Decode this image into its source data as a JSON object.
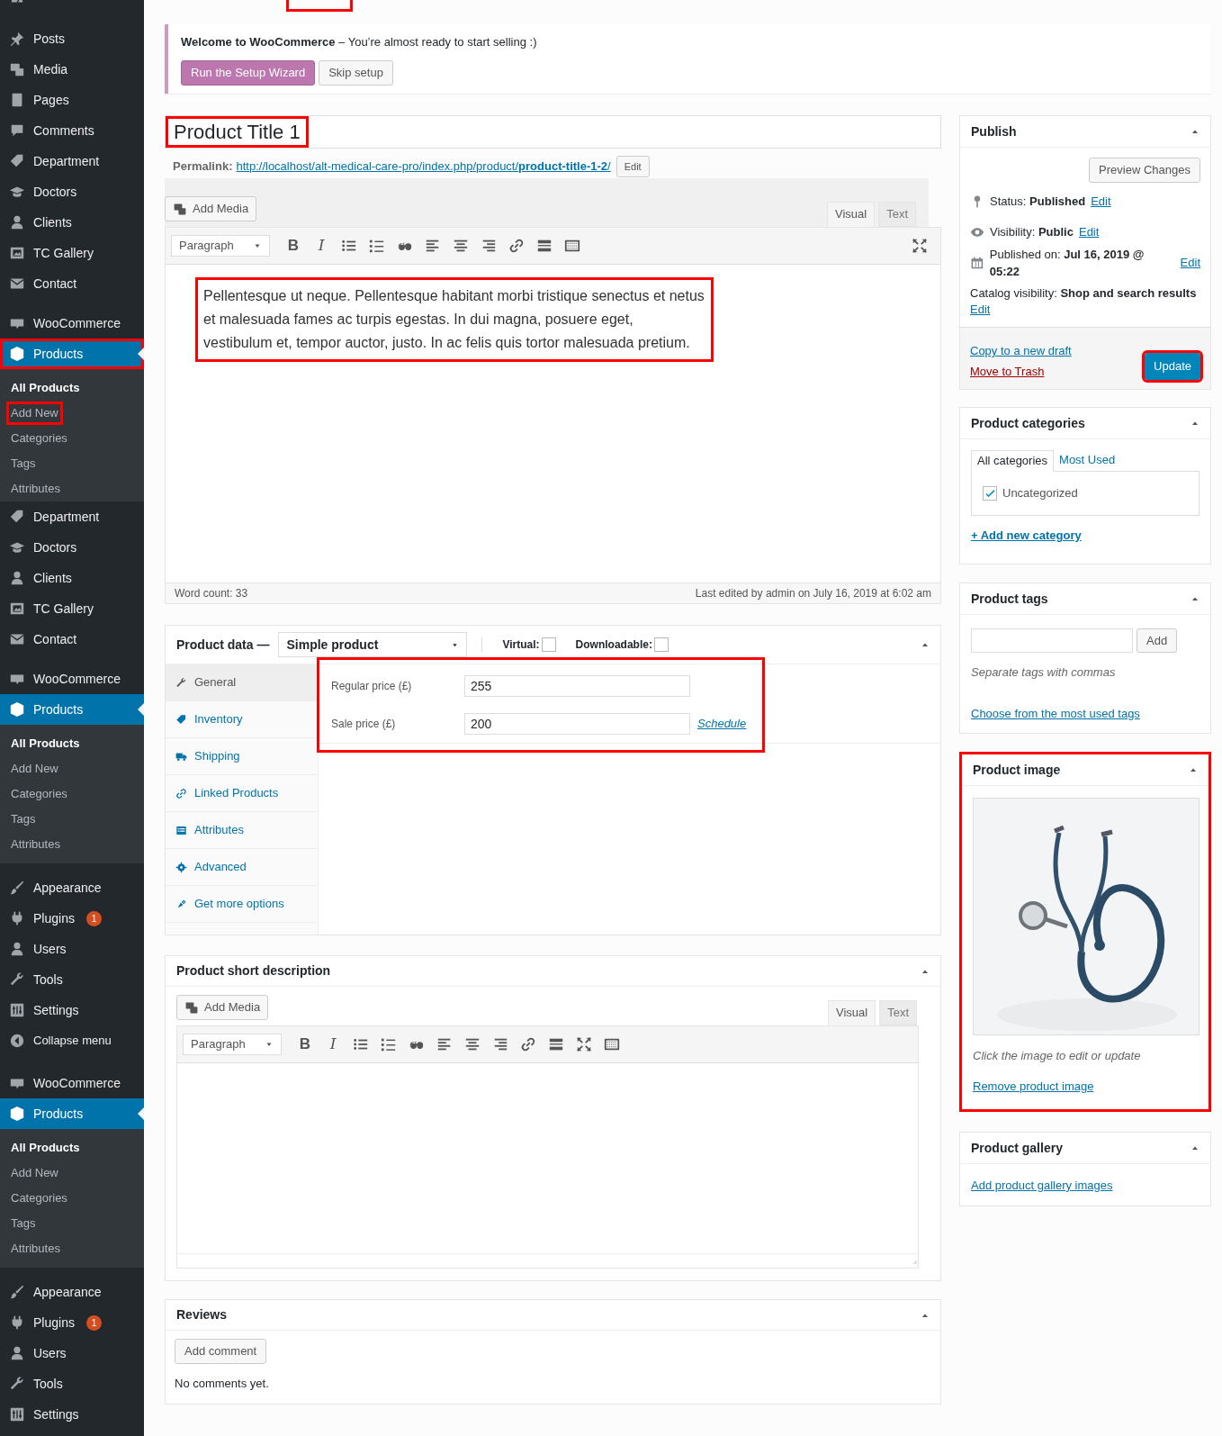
{
  "sidebar": {
    "groups": [
      [
        {
          "kind": "menu",
          "selected": false,
          "highlighted": false
        }
      ],
      [
        {
          "label": "Posts",
          "kind": "menu",
          "selected": false,
          "highlighted": false
        },
        {
          "label": "Media",
          "kind": "menu",
          "selected": false,
          "highlighted": false
        },
        {
          "label": "Pages",
          "kind": "menu",
          "selected": false,
          "highlighted": false
        },
        {
          "label": "Comments",
          "kind": "menu",
          "selected": false,
          "highlighted": false
        },
        {
          "label": "Department",
          "kind": "menu",
          "selected": false,
          "highlighted": false
        },
        {
          "label": "Doctors",
          "kind": "menu",
          "selected": false,
          "highlighted": false
        },
        {
          "label": "Clients",
          "kind": "menu",
          "selected": false,
          "highlighted": false
        },
        {
          "label": "TC Gallery",
          "kind": "menu",
          "selected": false,
          "highlighted": false
        },
        {
          "label": "Contact",
          "kind": "menu",
          "selected": false,
          "highlighted": false
        }
      ],
      [
        {
          "label": "WooCommerce",
          "kind": "menu",
          "selected": false,
          "highlighted": false
        },
        {
          "label": "Products",
          "kind": "menu",
          "selected": true,
          "highlighted": true,
          "children": [
            {
              "label": "All Products",
              "selected": true,
              "highlighted": false
            },
            {
              "label": "Add New",
              "selected": false,
              "highlighted": true
            },
            {
              "label": "Categories",
              "selected": false,
              "highlighted": false
            },
            {
              "label": "Tags",
              "selected": false,
              "highlighted": false
            },
            {
              "label": "Attributes",
              "selected": false,
              "highlighted": false
            }
          ]
        },
        {
          "label": "Department",
          "kind": "menu",
          "selected": false,
          "highlighted": false
        },
        {
          "label": "Doctors",
          "kind": "menu",
          "selected": false,
          "highlighted": false
        },
        {
          "label": "Clients",
          "kind": "menu",
          "selected": false,
          "highlighted": false
        },
        {
          "label": "TC Gallery",
          "kind": "menu",
          "selected": false,
          "highlighted": false
        },
        {
          "label": "Contact",
          "kind": "menu",
          "selected": false,
          "highlighted": false
        }
      ],
      [
        {
          "label": "WooCommerce",
          "kind": "menu",
          "selected": false,
          "highlighted": false
        },
        {
          "label": "Products",
          "kind": "menu",
          "selected": true,
          "highlighted": false,
          "children": [
            {
              "label": "All Products",
              "selected": true,
              "highlighted": false
            },
            {
              "label": "Add New",
              "selected": false,
              "highlighted": false
            },
            {
              "label": "Categories",
              "selected": false,
              "highlighted": false
            },
            {
              "label": "Tags",
              "selected": false,
              "highlighted": false
            },
            {
              "label": "Attributes",
              "selected": false,
              "highlighted": false
            }
          ]
        }
      ],
      [
        {
          "label": "Appearance",
          "kind": "menu",
          "selected": false,
          "highlighted": false
        },
        {
          "label": "Plugins",
          "kind": "menu",
          "selected": false,
          "highlighted": false,
          "badge": "1"
        },
        {
          "label": "Users",
          "kind": "menu",
          "selected": false,
          "highlighted": false
        },
        {
          "label": "Tools",
          "kind": "menu",
          "selected": false,
          "highlighted": false
        },
        {
          "label": "Settings",
          "kind": "menu",
          "selected": false,
          "highlighted": false
        },
        {
          "label": "Collapse menu",
          "kind": "collapse",
          "selected": false,
          "highlighted": false
        }
      ],
      [
        {
          "label": "WooCommerce",
          "kind": "menu",
          "selected": false,
          "highlighted": false
        },
        {
          "label": "Products",
          "kind": "menu",
          "selected": true,
          "highlighted": false,
          "children": [
            {
              "label": "All Products",
              "selected": true,
              "highlighted": false
            },
            {
              "label": "Add New",
              "selected": false,
              "highlighted": false
            },
            {
              "label": "Categories",
              "selected": false,
              "highlighted": false
            },
            {
              "label": "Tags",
              "selected": false,
              "highlighted": false
            },
            {
              "label": "Attributes",
              "selected": false,
              "highlighted": false
            }
          ]
        }
      ],
      [
        {
          "label": "Appearance",
          "kind": "menu",
          "selected": false,
          "highlighted": false
        },
        {
          "label": "Plugins",
          "kind": "menu",
          "selected": false,
          "highlighted": false,
          "badge": "1"
        },
        {
          "label": "Users",
          "kind": "menu",
          "selected": false,
          "highlighted": false
        },
        {
          "label": "Tools",
          "kind": "menu",
          "selected": false,
          "highlighted": false
        },
        {
          "label": "Settings",
          "kind": "menu",
          "selected": false,
          "highlighted": false
        }
      ]
    ]
  },
  "header": {
    "add_new": {
      "highlighted": true
    }
  },
  "notice": {
    "text": "**Welcome to WooCommerce** – You’re almost ready to start selling :)",
    "buttons": [
      {
        "label": "Run the Setup Wizard",
        "kind": "primary"
      },
      {
        "label": "Skip setup",
        "kind": "secondary"
      }
    ]
  },
  "title_field": {
    "value": "Product Title 1",
    "highlighted": true
  },
  "permalink": {
    "label": "Permalink:",
    "url_base": "http://localhost/alt-medical-care-pro/index.php/product/",
    "slug": "product-title-1-2",
    "trailing": "/",
    "edit_button": "Edit"
  },
  "editor": {
    "add_media": "Add Media",
    "tabs": [
      {
        "label": "Visual",
        "selected": true
      },
      {
        "label": "Text",
        "selected": false
      }
    ],
    "format": "Paragraph",
    "format_buttons": [
      {
        "label": "B",
        "kind": "bold"
      },
      {
        "label": "I",
        "kind": "italic"
      }
    ],
    "content": "Pellentesque ut neque. Pellentesque habitant morbi tristique senectus et netus et malesuada fames ac turpis egestas. In dui magna, posuere eget, vestibulum et, tempor auctor, justo. In ac felis quis tortor malesuada pretium.",
    "content_highlighted": true,
    "word_count": "Word count: 33",
    "last_edited": "Last edited by admin on July 16, 2019 at 6:02 am"
  },
  "product_data": {
    "title": "Product data —",
    "type": "Simple product",
    "options": [
      {
        "label": "Virtual:",
        "checked": false
      },
      {
        "label": "Downloadable:",
        "checked": false
      }
    ],
    "tabs": [
      {
        "label": "General",
        "selected": true
      },
      {
        "label": "Inventory",
        "selected": false
      },
      {
        "label": "Shipping",
        "selected": false
      },
      {
        "label": "Linked Products",
        "selected": false
      },
      {
        "label": "Attributes",
        "selected": false
      },
      {
        "label": "Advanced",
        "selected": false
      },
      {
        "label": "Get more options",
        "selected": false
      }
    ],
    "fields": [
      {
        "label": "Regular price (£)",
        "value": "255"
      },
      {
        "label": "Sale price (£)",
        "value": "200",
        "link": "Schedule"
      }
    ],
    "fields_highlighted": true
  },
  "short_description": {
    "title": "Product short description",
    "add_media": "Add Media",
    "tabs": [
      {
        "label": "Visual",
        "selected": true
      },
      {
        "label": "Text",
        "selected": false
      }
    ],
    "format": "Paragraph",
    "format_buttons": [
      {
        "label": "B",
        "kind": "bold"
      },
      {
        "label": "I",
        "kind": "italic"
      }
    ]
  },
  "reviews": {
    "title": "Reviews",
    "button": "Add comment",
    "empty": "No comments yet."
  },
  "publish": {
    "title": "Publish",
    "preview": "Preview Changes",
    "rows": [
      {
        "text": "Status: **Published**",
        "link": "Edit"
      },
      {
        "text": "Visibility: **Public**",
        "link": "Edit"
      },
      {
        "text": "Published on: **Jul 16, 2019 @ 05:22**",
        "link": "Edit"
      }
    ],
    "catalog": {
      "text": "Catalog visibility: **Shop and search results**",
      "link": "Edit"
    },
    "copy_link": "Copy to a new draft",
    "trash_link": "Move to Trash",
    "update": {
      "label": "Update",
      "highlighted": true
    }
  },
  "categories": {
    "title": "Product categories",
    "tabs": [
      {
        "label": "All categories",
        "selected": true
      },
      {
        "label": "Most Used",
        "selected": false
      }
    ],
    "items": [
      {
        "label": "Uncategorized",
        "checked": true
      }
    ],
    "add_link": "+ Add new category"
  },
  "tags": {
    "title": "Product tags",
    "button": "Add",
    "hint": "Separate tags with commas",
    "link": "Choose from the most used tags"
  },
  "image": {
    "title": "Product image",
    "caption": "Click the image to edit or update",
    "remove_link": "Remove product image",
    "highlighted": true
  },
  "gallery": {
    "title": "Product gallery",
    "link": "Add product gallery images"
  }
}
